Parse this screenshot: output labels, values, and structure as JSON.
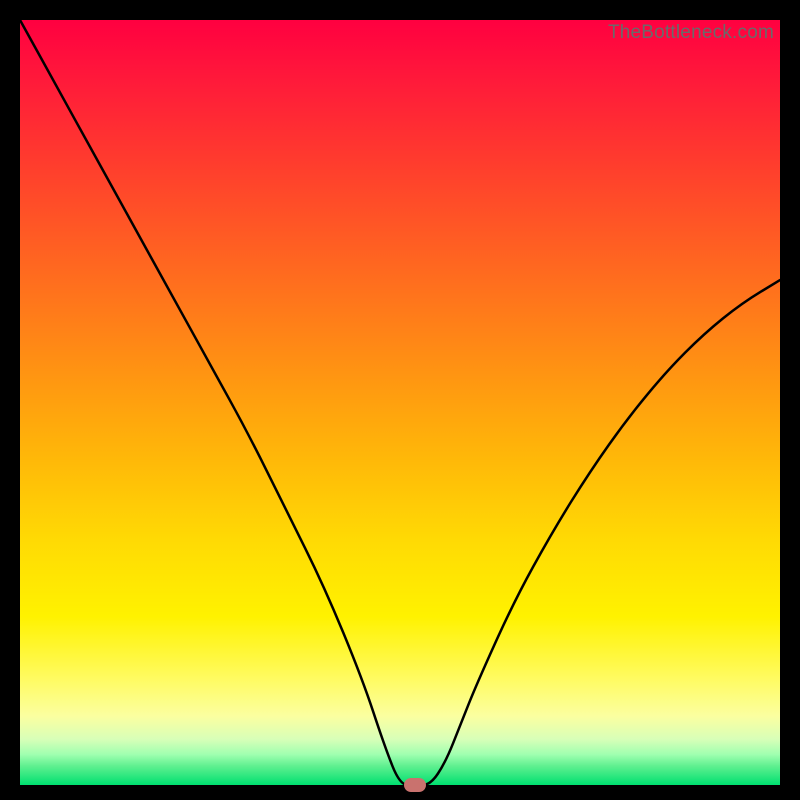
{
  "watermark": "TheBottleneck.com",
  "chart_data": {
    "type": "line",
    "title": "",
    "xlabel": "",
    "ylabel": "",
    "xlim": [
      0,
      100
    ],
    "ylim": [
      0,
      100
    ],
    "series": [
      {
        "name": "curve",
        "x": [
          0,
          5,
          10,
          15,
          20,
          25,
          30,
          35,
          40,
          45,
          48,
          50,
          52,
          54,
          56,
          58,
          60,
          65,
          70,
          75,
          80,
          85,
          90,
          95,
          100
        ],
        "values": [
          100,
          91,
          82,
          73,
          64,
          55,
          46,
          36,
          26,
          14,
          5,
          0,
          0,
          0,
          3,
          8,
          13,
          24,
          33,
          41,
          48,
          54,
          59,
          63,
          66
        ]
      }
    ],
    "marker": {
      "x": 52,
      "y": 0,
      "color": "#c9726e"
    },
    "gradient_stops": [
      {
        "offset": 0,
        "color": "#ff0040"
      },
      {
        "offset": 50,
        "color": "#ffba08"
      },
      {
        "offset": 80,
        "color": "#fff200"
      },
      {
        "offset": 100,
        "color": "#00e070"
      }
    ]
  }
}
